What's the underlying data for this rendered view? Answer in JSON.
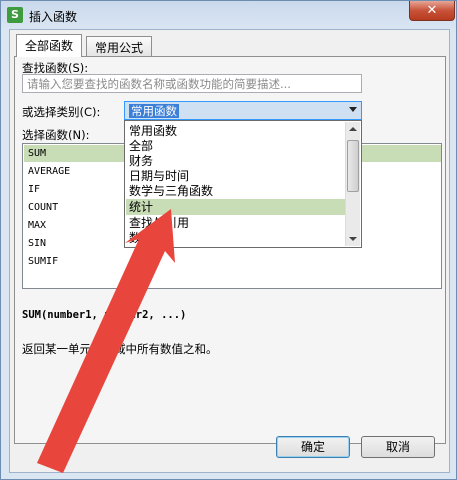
{
  "window": {
    "icon_glyph": "S",
    "title": "插入函数",
    "close_glyph": "✕"
  },
  "tabs": [
    {
      "label": "全部函数",
      "active": true
    },
    {
      "label": "常用公式",
      "active": false
    }
  ],
  "search": {
    "label": "查找函数(S):",
    "placeholder": "请输入您要查找的函数名称或函数功能的简要描述..."
  },
  "category": {
    "label": "或选择类别(C):",
    "selected": "常用函数",
    "options": [
      "常用函数",
      "全部",
      "财务",
      "日期与时间",
      "数学与三角函数",
      "统计",
      "查找与引用",
      "数据库"
    ],
    "highlighted": "统计"
  },
  "functions": {
    "label": "选择函数(N):",
    "items": [
      "SUM",
      "AVERAGE",
      "IF",
      "COUNT",
      "MAX",
      "SIN",
      "SUMIF"
    ],
    "selected": "SUM"
  },
  "syntax": "SUM(number1, number2, ...)",
  "description": "返回某一单元格区域中所有数值之和。",
  "buttons": {
    "ok": "确定",
    "cancel": "取消"
  },
  "colors": {
    "annotation_arrow": "#e8453c",
    "highlight": "#c8dcb5",
    "selection_blue": "#3c7fd6"
  }
}
